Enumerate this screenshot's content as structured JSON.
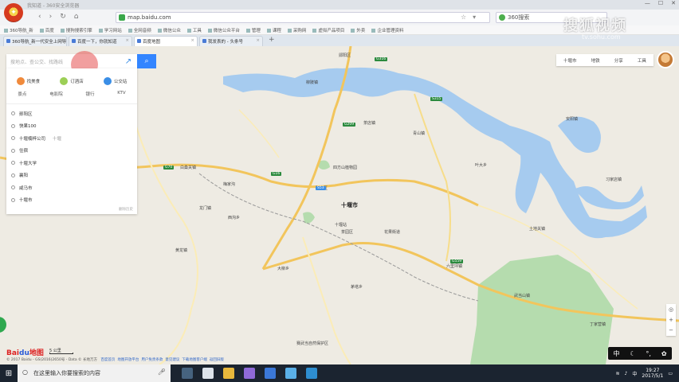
{
  "browser": {
    "window_title": "我知道 - 360安全浏览器",
    "url": "map.baidu.com",
    "search_engine_label": "360搜索",
    "nav_back": "‹",
    "nav_forward": "›",
    "nav_refresh": "↻",
    "nav_home": "⌂",
    "bookmarks": [
      "360导航_新",
      "百度",
      "搜狗搜索引擎",
      "学习网站",
      "全网音频",
      "微信公众",
      "工具",
      "微信公众平台",
      "管理",
      "课程",
      "采购网",
      "虚拟产品项目",
      "外卖",
      "企业管理资料"
    ],
    "tabs": [
      {
        "label": "360导航_新一代安全上网导航",
        "active": false
      },
      {
        "label": "百度一下，你就知道",
        "active": false
      },
      {
        "label": "百度地图",
        "active": true
      },
      {
        "label": "我发表的 - 头条号",
        "active": false
      }
    ],
    "new_tab": "+"
  },
  "watermark": {
    "brand": "搜狐视频",
    "domain": "tv.sohu.com"
  },
  "search": {
    "placeholder": "搜地点、查公交、找路线",
    "button_icon": "search-icon",
    "route_tooltip": "路线"
  },
  "quick_links": [
    {
      "label": "找美食",
      "color": "#f08a3c",
      "icon": "food-icon"
    },
    {
      "label": "订酒店",
      "color": "#9ccf56",
      "icon": "hotel-icon"
    },
    {
      "label": "公交站",
      "color": "#3a8ee6",
      "icon": "bus-icon"
    }
  ],
  "categories": [
    "景点",
    "电影院",
    "银行",
    "KTV"
  ],
  "history": [
    {
      "label": "郧阳区",
      "tag": ""
    },
    {
      "label": "快果100",
      "tag": ""
    },
    {
      "label": "十堰楠梓公司",
      "tag": "十堰"
    },
    {
      "label": "住宿",
      "tag": ""
    },
    {
      "label": "十堰大学",
      "tag": ""
    },
    {
      "label": "襄阳",
      "tag": ""
    },
    {
      "label": "咸马市",
      "tag": ""
    },
    {
      "label": "十堰市",
      "tag": ""
    }
  ],
  "clear_history": "删除历史",
  "map_tools": {
    "city": "十堰市",
    "subway": "地铁",
    "share": "分享",
    "tools": "工具"
  },
  "map_labels": {
    "main_city": "十堰市",
    "places": [
      "柳陂镇",
      "茶店镇",
      "青山镇",
      "安阳镇",
      "白桑关镇",
      "大柳乡",
      "茅塔乡",
      "黄龙镇",
      "花果街道",
      "武当山镇",
      "六里坪镇",
      "龙门镇",
      "梅家沟",
      "习家店镇",
      "土地关镇",
      "西沟乡",
      "十堰站",
      "丁家营镇",
      "茶园区",
      "张湾区",
      "郧阳区",
      "叶大乡",
      "赛武当自然保护区",
      "四方山植物园"
    ],
    "routes": [
      "G70",
      "G16",
      "G209",
      "G559",
      "S53",
      "G316",
      "S315"
    ]
  },
  "scale_label": "5 公里",
  "copyright": "© 2017 Baidu - GS(2016)2650号 - Data © 长地万方",
  "copyright_links": [
    "百度首页",
    "地图开放平台",
    "用户免责条款",
    "意见建议",
    "下载地图客户端",
    "返回旧版"
  ],
  "ime": {
    "lang": "中"
  },
  "taskbar": {
    "search_placeholder": "在这里输入你要搜索的内容",
    "time": "19:27",
    "date": "2017/5/1"
  }
}
